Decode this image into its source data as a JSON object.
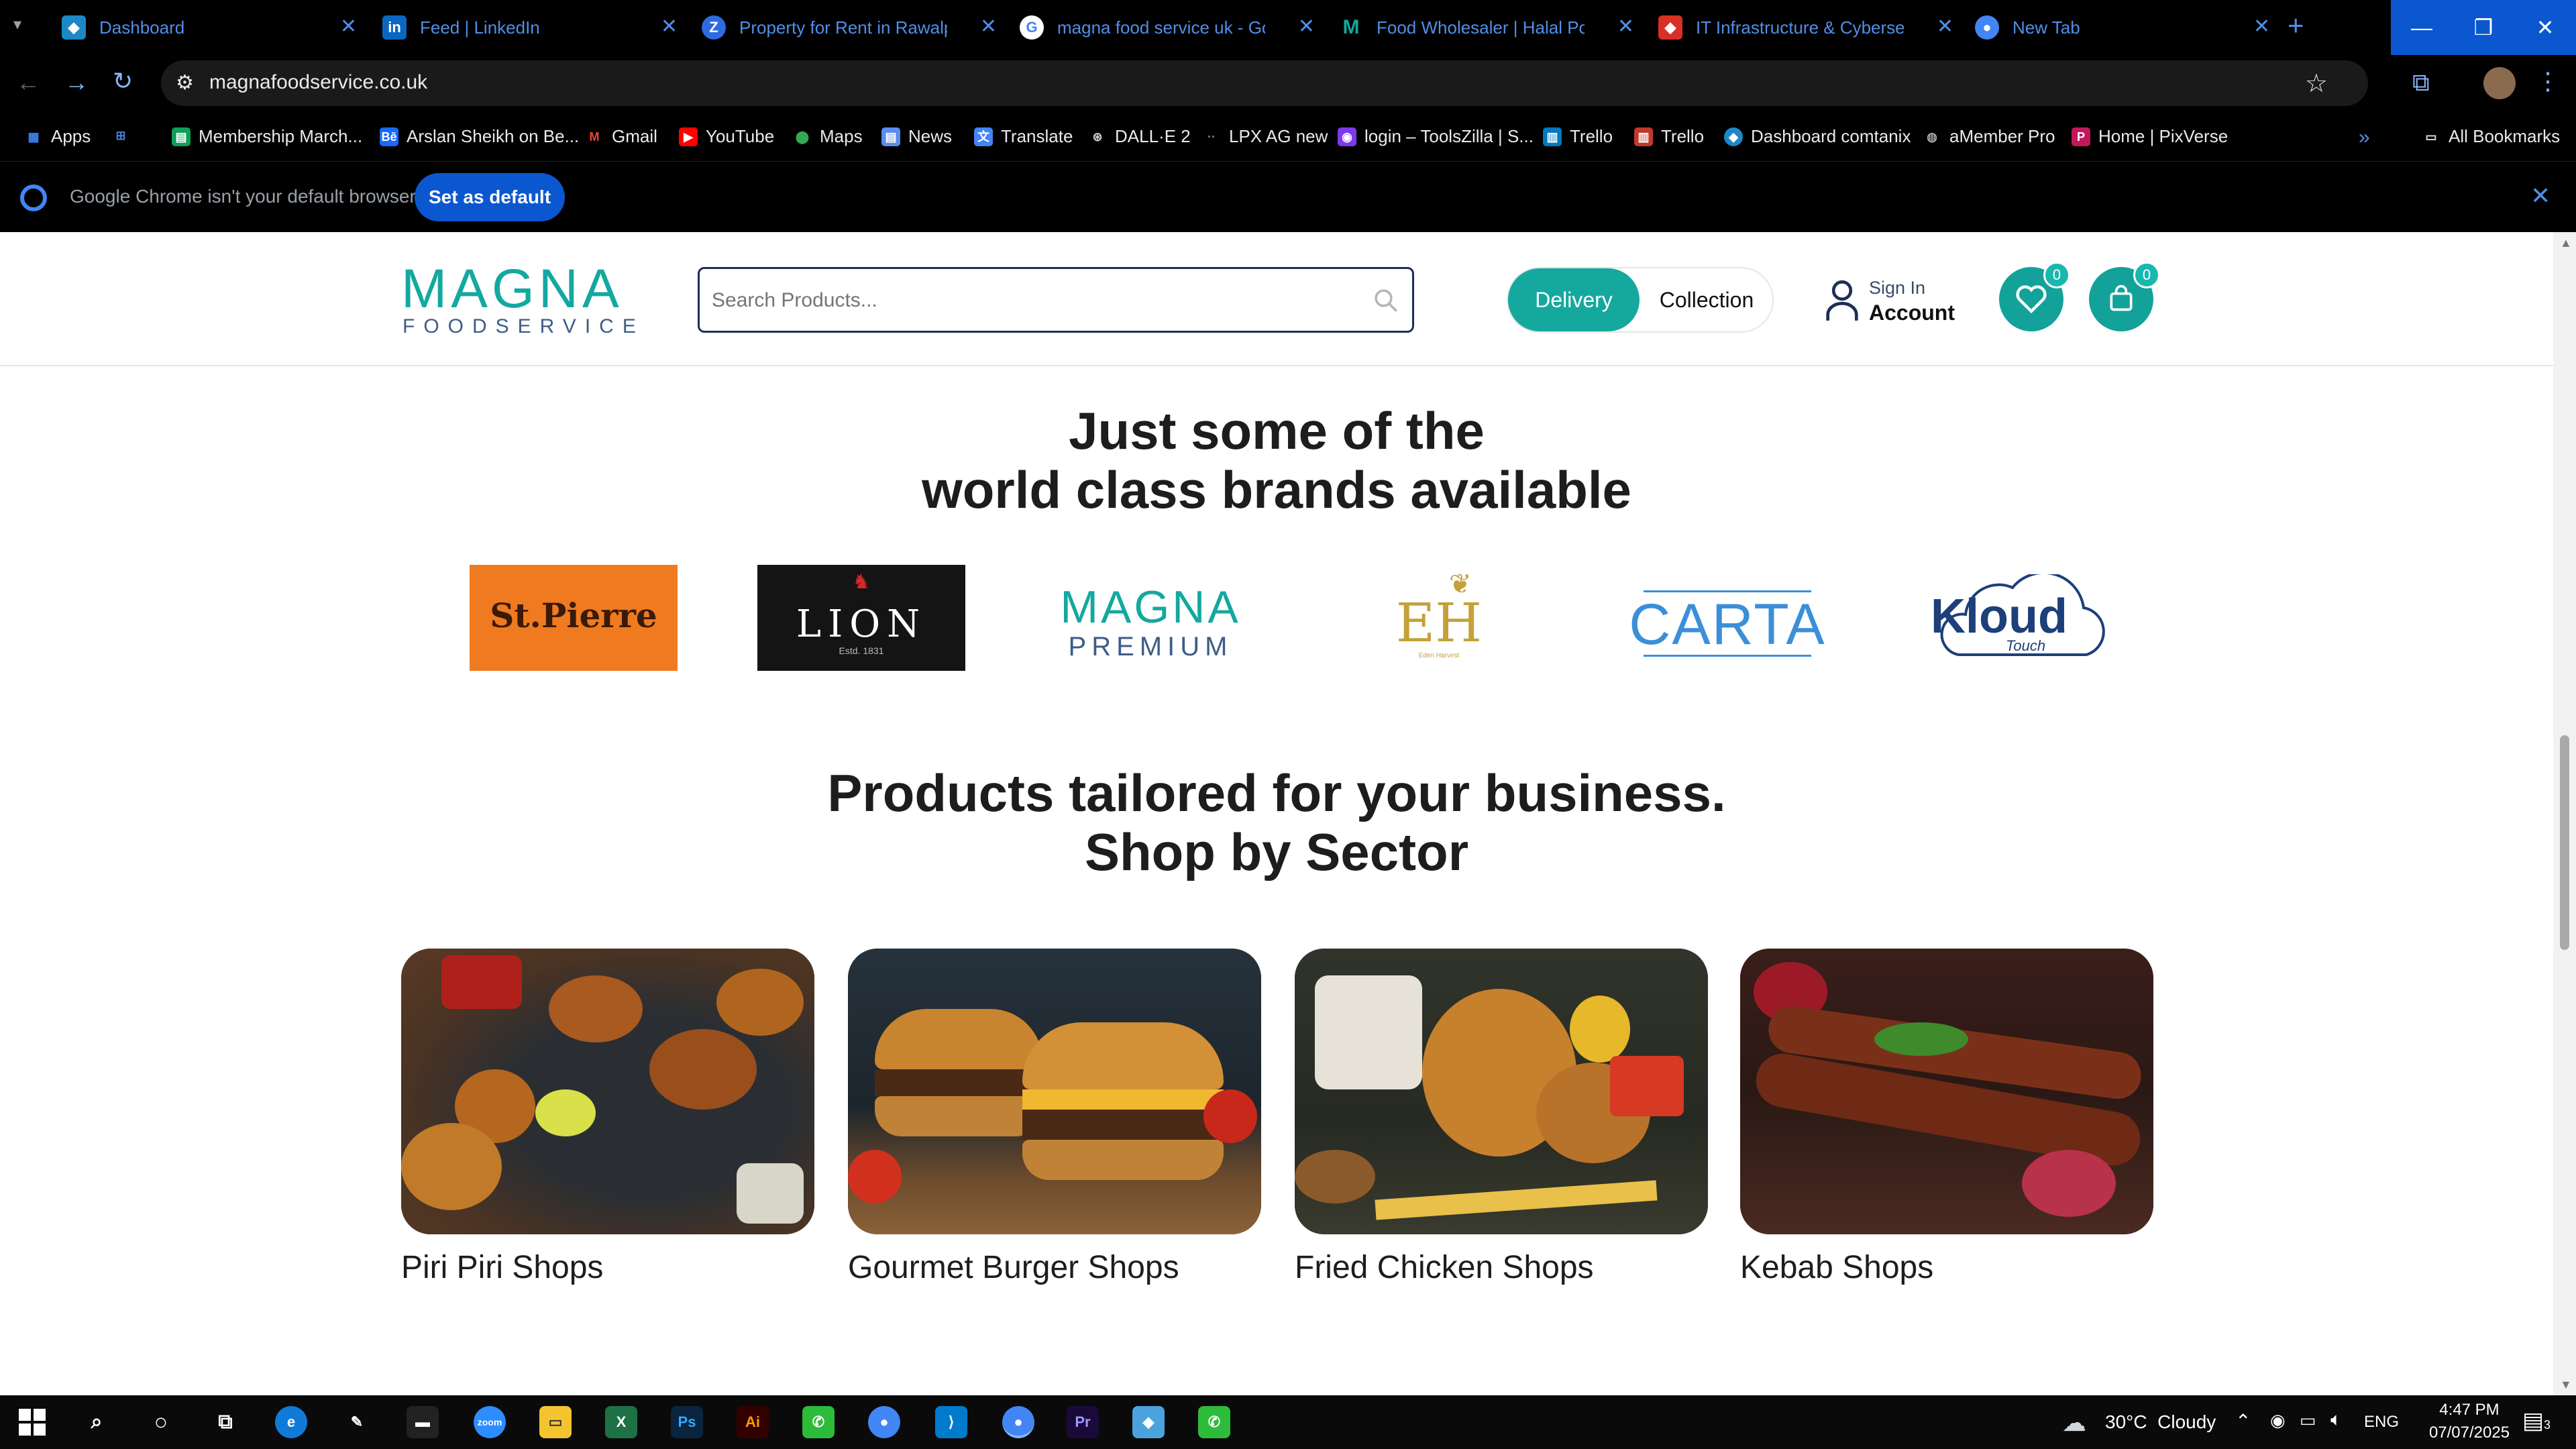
{
  "browser": {
    "tabs": [
      {
        "title": "Dashboard",
        "icon": "dashboard-favicon",
        "color": "#1e88c7"
      },
      {
        "title": "Feed | LinkedIn",
        "icon": "linkedin-icon",
        "color": "#0a66c2"
      },
      {
        "title": "Property for Rent in Rawalpindi",
        "icon": "property-favicon",
        "color": "#2d6be0"
      },
      {
        "title": "magna food service uk - Google Search",
        "icon": "google-icon",
        "color": "#4285f4"
      },
      {
        "title": "Food Wholesaler | Halal Poultry",
        "icon": "magna-favicon",
        "color": "#13a8a0"
      },
      {
        "title": "IT Infrastructure & Cybersecurity",
        "icon": "it-favicon",
        "color": "#d93025"
      },
      {
        "title": "New Tab",
        "icon": "chrome-icon",
        "color": "#4285f4"
      }
    ],
    "new_tab_label": "+",
    "url": "magnafoodservice.co.uk",
    "bookmarks": [
      {
        "label": "Apps",
        "icon": "apps-grid-icon",
        "color": "#4285f4"
      },
      {
        "label": "",
        "icon": "grid-icon",
        "color": "#4a7bd0"
      },
      {
        "label": "Membership March...",
        "icon": "sheets-icon",
        "color": "#0f9d58"
      },
      {
        "label": "Arslan Sheikh on Be...",
        "icon": "behance-icon",
        "color": "#1769ff"
      },
      {
        "label": "Gmail",
        "icon": "gmail-icon",
        "color": "#ea4335"
      },
      {
        "label": "YouTube",
        "icon": "youtube-icon",
        "color": "#ff0000"
      },
      {
        "label": "Maps",
        "icon": "maps-icon",
        "color": "#34a853"
      },
      {
        "label": "News",
        "icon": "news-icon",
        "color": "#5b8def"
      },
      {
        "label": "Translate",
        "icon": "translate-icon",
        "color": "#4285f4"
      },
      {
        "label": "DALL·E 2",
        "icon": "openai-icon",
        "color": "#555555"
      },
      {
        "label": "LPX AG new",
        "icon": "dots-icon",
        "color": "#555555"
      },
      {
        "label": "login – ToolsZilla | S...",
        "icon": "toolszilla-icon",
        "color": "#7c3aed"
      },
      {
        "label": "Trello",
        "icon": "trello-icon",
        "color": "#0079bf"
      },
      {
        "label": "Trello",
        "icon": "trello-icon",
        "color": "#c0392b"
      },
      {
        "label": "Dashboard comtanix",
        "icon": "comtanix-icon",
        "color": "#1e88c7"
      },
      {
        "label": "aMember Pro",
        "icon": "amember-icon",
        "color": "#888888"
      },
      {
        "label": "Home | PixVerse",
        "icon": "pixverse-icon",
        "color": "#c2185b"
      }
    ],
    "all_bookmarks_label": "All Bookmarks",
    "infobar": {
      "message": "Google Chrome isn't your default browser",
      "button": "Set as default"
    }
  },
  "site": {
    "logo_main": "MAGNA",
    "logo_sub": "FOODSERVICE",
    "search_placeholder": "Search Products...",
    "delivery_label": "Delivery",
    "collection_label": "Collection",
    "sign_in_label": "Sign In",
    "account_label": "Account",
    "wishlist_count": "0",
    "cart_count": "0",
    "brands_heading_line1": "Just some of the",
    "brands_heading_line2": "world class brands available",
    "brands": [
      {
        "name": "St.Pierre",
        "bg": "#ef7a1f"
      },
      {
        "name": "LION",
        "sub": "Estd. 1831",
        "bg": "#141414"
      },
      {
        "name": "MAGNA",
        "sub": "PREMIUM",
        "bg": "#ffffff"
      },
      {
        "name": "EH",
        "sub": "Eden Harvest",
        "bg": "#ffffff"
      },
      {
        "name": "CARTA",
        "bg": "#ffffff"
      },
      {
        "name": "Kloud",
        "sub": "Touch",
        "bg": "#ffffff"
      }
    ],
    "sector_heading_line1": "Products tailored for your business.",
    "sector_heading_line2": "Shop by Sector",
    "sectors": [
      {
        "label": "Piri Piri Shops",
        "image": "grilled-chicken-photo"
      },
      {
        "label": "Gourmet Burger Shops",
        "image": "burgers-photo"
      },
      {
        "label": "Fried Chicken Shops",
        "image": "fried-chicken-photo"
      },
      {
        "label": "Kebab Shops",
        "image": "kebab-photo"
      }
    ]
  },
  "taskbar": {
    "apps": [
      {
        "icon": "search-icon",
        "color": "#0a0a0a"
      },
      {
        "icon": "cortana-icon",
        "color": "#0a0a0a"
      },
      {
        "icon": "task-view-icon",
        "color": "#0a0a0a"
      },
      {
        "icon": "edge-icon",
        "color": "#0f7ad8"
      },
      {
        "icon": "pen-icon",
        "color": "#0a0a0a"
      },
      {
        "icon": "terminal-icon",
        "color": "#222222"
      },
      {
        "icon": "zoom-icon",
        "color": "#2d8cff"
      },
      {
        "icon": "file-explorer-icon",
        "color": "#f4c430"
      },
      {
        "icon": "excel-icon",
        "color": "#1e7145"
      },
      {
        "icon": "photoshop-icon",
        "color": "#0a2540"
      },
      {
        "icon": "illustrator-icon",
        "color": "#330000"
      },
      {
        "icon": "green-app-icon",
        "color": "#2dbb3a"
      },
      {
        "icon": "chrome-icon",
        "color": "#4285f4"
      },
      {
        "icon": "vscode-icon",
        "color": "#007acc"
      },
      {
        "icon": "chrome-active-icon",
        "color": "#4285f4"
      },
      {
        "icon": "premiere-icon",
        "color": "#1a0a3a"
      },
      {
        "icon": "vpn-app-icon",
        "color": "#4aa3df"
      },
      {
        "icon": "green-app-2-icon",
        "color": "#2dbb3a"
      }
    ],
    "weather": "30°C  Cloudy",
    "language": "ENG",
    "time": "4:47 PM",
    "date": "07/07/2025",
    "notification_count": "3"
  }
}
